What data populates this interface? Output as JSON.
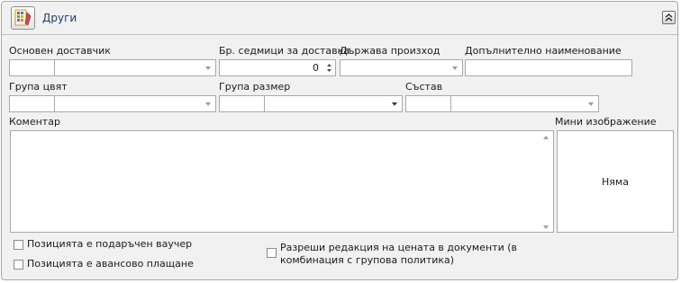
{
  "header": {
    "title": "Други",
    "icon": "palette-icon",
    "collapse_icon": "double-chevron-up-icon"
  },
  "fields": {
    "main_supplier": {
      "label": "Основен доставчик",
      "code": "",
      "value": ""
    },
    "delivery_weeks": {
      "label": "Бр. седмици за доставка",
      "value": "0"
    },
    "country": {
      "label": "Държава произход",
      "value": ""
    },
    "additional_name": {
      "label": "Допълнително наименование",
      "value": ""
    },
    "color_group": {
      "label": "Група цвят",
      "code": "",
      "value": ""
    },
    "size_group": {
      "label": "Група размер",
      "code": "",
      "value": ""
    },
    "composition": {
      "label": "Състав",
      "code": "",
      "value": ""
    },
    "comment": {
      "label": "Коментар",
      "value": ""
    },
    "thumbnail": {
      "label": "Мини изображение",
      "empty_text": "Няма"
    }
  },
  "checkboxes": {
    "gift_voucher": {
      "label": "Позицията е подаръчен ваучер",
      "checked": false
    },
    "advance_payment": {
      "label": "Позицията е авансово плащане",
      "checked": false
    },
    "price_edit": {
      "line1": "Разреши редакция на цената в документи (в",
      "line2": "комбинация с групова политика)",
      "checked": false
    }
  }
}
